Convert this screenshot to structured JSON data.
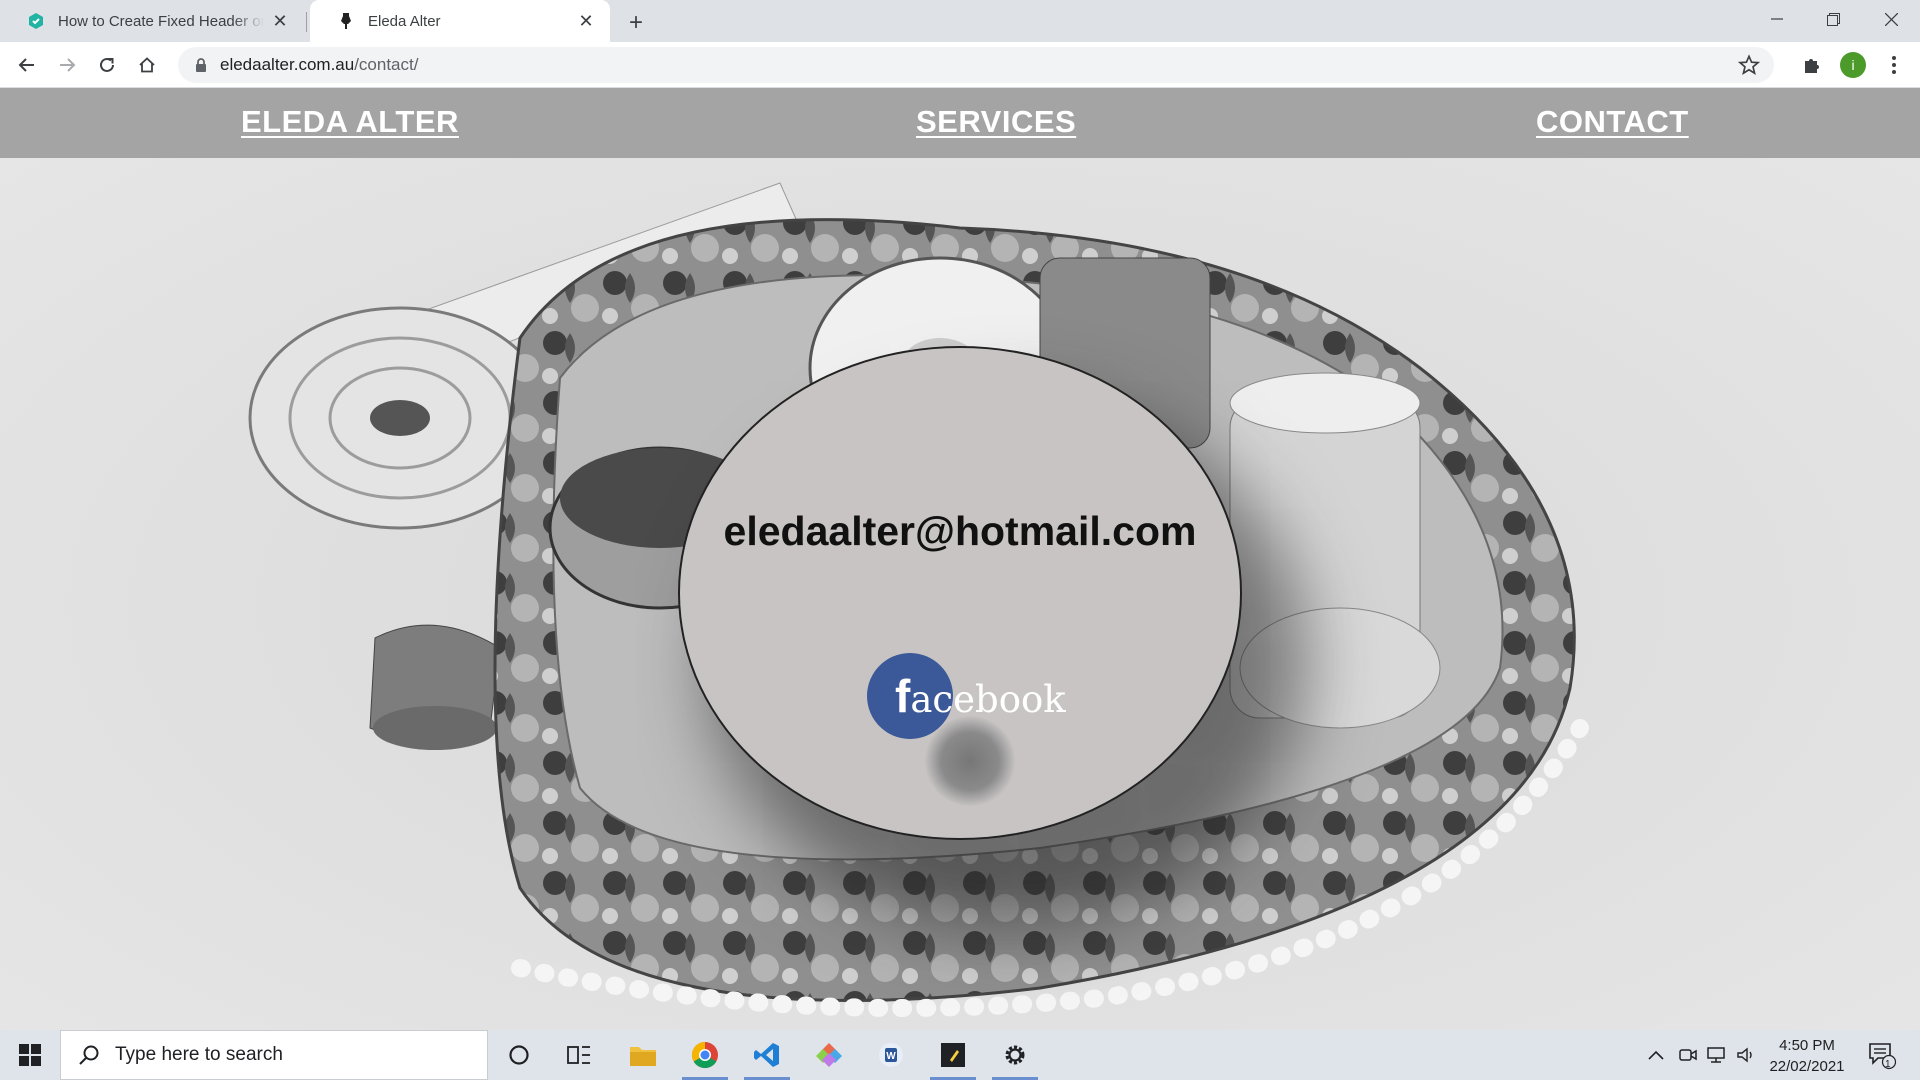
{
  "browser": {
    "tabs": [
      {
        "title": "How to Create Fixed Header or Footer",
        "favicon": "hexagon-app-icon",
        "active": false
      },
      {
        "title": "Eleda Alter",
        "favicon": "dress-form-icon",
        "active": true
      }
    ],
    "new_tab_label": "+",
    "address": {
      "host": "eledaalter.com.au",
      "path": "/contact/"
    },
    "profile_initial": "i"
  },
  "site": {
    "nav": {
      "brand": "ELEDA ALTER",
      "services": "SERVICES",
      "contact": "CONTACT"
    },
    "contact": {
      "email": "eledaalter@hotmail.com",
      "facebook_f": "f",
      "facebook_rest": "acebook"
    }
  },
  "taskbar": {
    "search_placeholder": "Type here to search",
    "time": "4:50 PM",
    "date": "22/02/2021",
    "notification_count": "1"
  },
  "colors": {
    "nav_bar": "#a4a4a4",
    "facebook_blue": "#3b5998",
    "circle_fill": "#c8c4c4",
    "chrome_tabstrip": "#dee1e6"
  }
}
